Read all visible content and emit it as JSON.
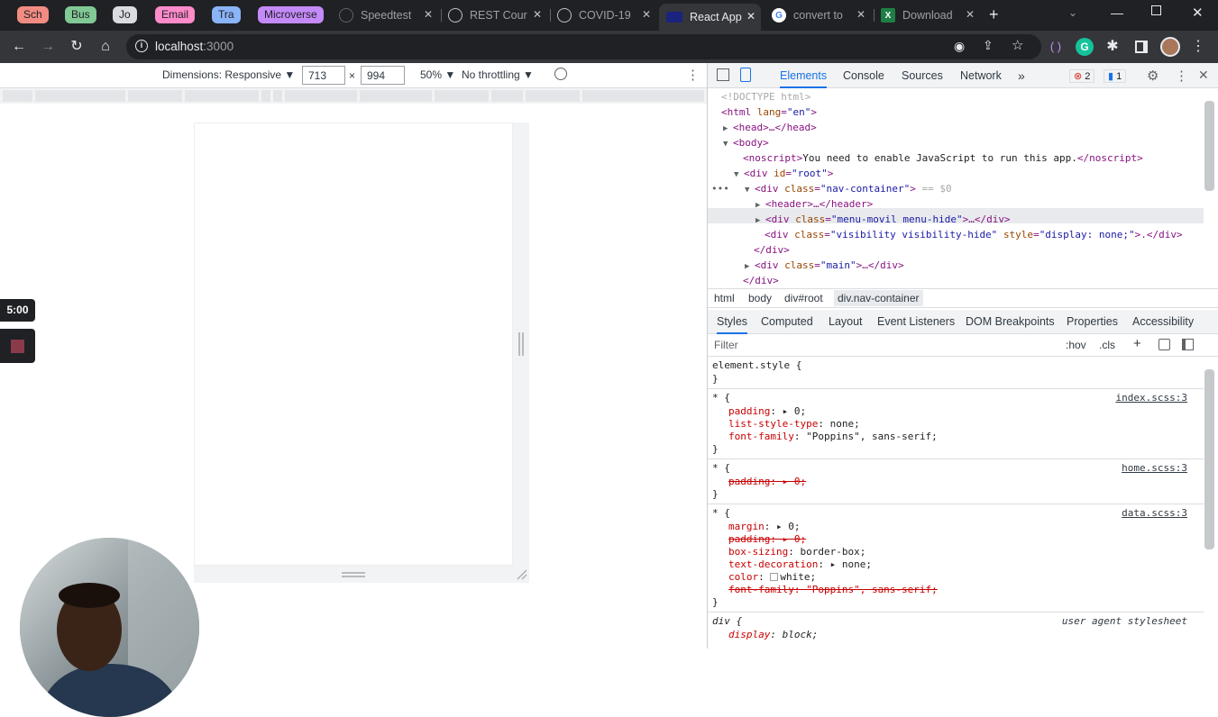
{
  "tab_groups": [
    {
      "label": "Sch",
      "color": "#f28b82"
    },
    {
      "label": "Bus",
      "color": "#81c995"
    },
    {
      "label": "Jo",
      "color": "#dadce0"
    },
    {
      "label": "Email",
      "color": "#ff8bcb"
    },
    {
      "label": "Tra",
      "color": "#8ab4f8"
    },
    {
      "label": "Microverse",
      "color": "#c58af9"
    }
  ],
  "tabs": [
    {
      "title": "Speedtest"
    },
    {
      "title": "REST Cour"
    },
    {
      "title": "COVID-19"
    },
    {
      "title": "React App"
    },
    {
      "title": "convert to"
    },
    {
      "title": "Download"
    }
  ],
  "address": {
    "host": "localhost",
    "port": ":3000"
  },
  "device_toolbar": {
    "dimensions": "Dimensions: Responsive ▼",
    "width": "713",
    "times": "×",
    "height": "994",
    "zoom": "50% ▼",
    "throttling": "No throttling ▼"
  },
  "recorder": {
    "time": "5:00"
  },
  "devtools": {
    "tabs": [
      "Elements",
      "Console",
      "Sources",
      "Network",
      "»"
    ],
    "errors": "2",
    "messages": "1",
    "dom": {
      "doctype": "<!DOCTYPE html>",
      "html_open": "<html",
      "lang_attr": "lang",
      "lang_val": "\"en\"",
      "head": "<head>…</head>",
      "body": "<body>",
      "noscript_open": "<noscript>",
      "noscript_text": "You need to enable JavaScript to run this app.",
      "noscript_close": "</noscript>",
      "root_open": "<div",
      "id_attr": "id",
      "root_val": "\"root\"",
      "nav_open": "<div",
      "class_attr": "class",
      "nav_val": "\"nav-container\"",
      "eq0": "== $0",
      "header": "<header>…</header>",
      "menu_val": "\"menu-movil menu-hide\"",
      "ellipsis_div": ">…</div>",
      "vis_val": "\"visibility visibility-hide\"",
      "style_attr": "style",
      "style_val": "\"display: none;\"",
      "vis_end": ">.</div>",
      "div_close": "</div>",
      "main_val": "\"main\"",
      "dots": "•••"
    },
    "breadcrumbs": [
      "html",
      "body",
      "div#root",
      "div.nav-container"
    ],
    "subtabs": [
      "Styles",
      "Computed",
      "Layout",
      "Event Listeners",
      "DOM Breakpoints",
      "Properties",
      "Accessibility"
    ],
    "filter": {
      "placeholder": "Filter",
      "hov": ":hov",
      "cls": ".cls",
      "plus": "+"
    },
    "styles": {
      "element_style": "element.style {",
      "close": "}",
      "star_open": "* {",
      "div_open": "div {",
      "src_index": "index.scss:3",
      "src_home": "home.scss:3",
      "src_data": "data.scss:3",
      "ua": "user agent stylesheet",
      "padding": "padding",
      "padding_val": "0;",
      "list_style": "list-style-type",
      "list_style_val": "none;",
      "font_family": "font-family",
      "font_family_val": "\"Poppins\", sans-serif;",
      "margin": "margin",
      "margin_val": "0;",
      "box_sizing": "box-sizing",
      "box_sizing_val": "border-box;",
      "text_decoration": "text-decoration",
      "text_decoration_val": "none;",
      "color": "color",
      "color_val": "white;",
      "display": "display",
      "display_val": "block;",
      "strike_padding": "padding: ▸ 0;",
      "strike_font": "font-family: \"Poppins\", sans-serif;"
    }
  }
}
